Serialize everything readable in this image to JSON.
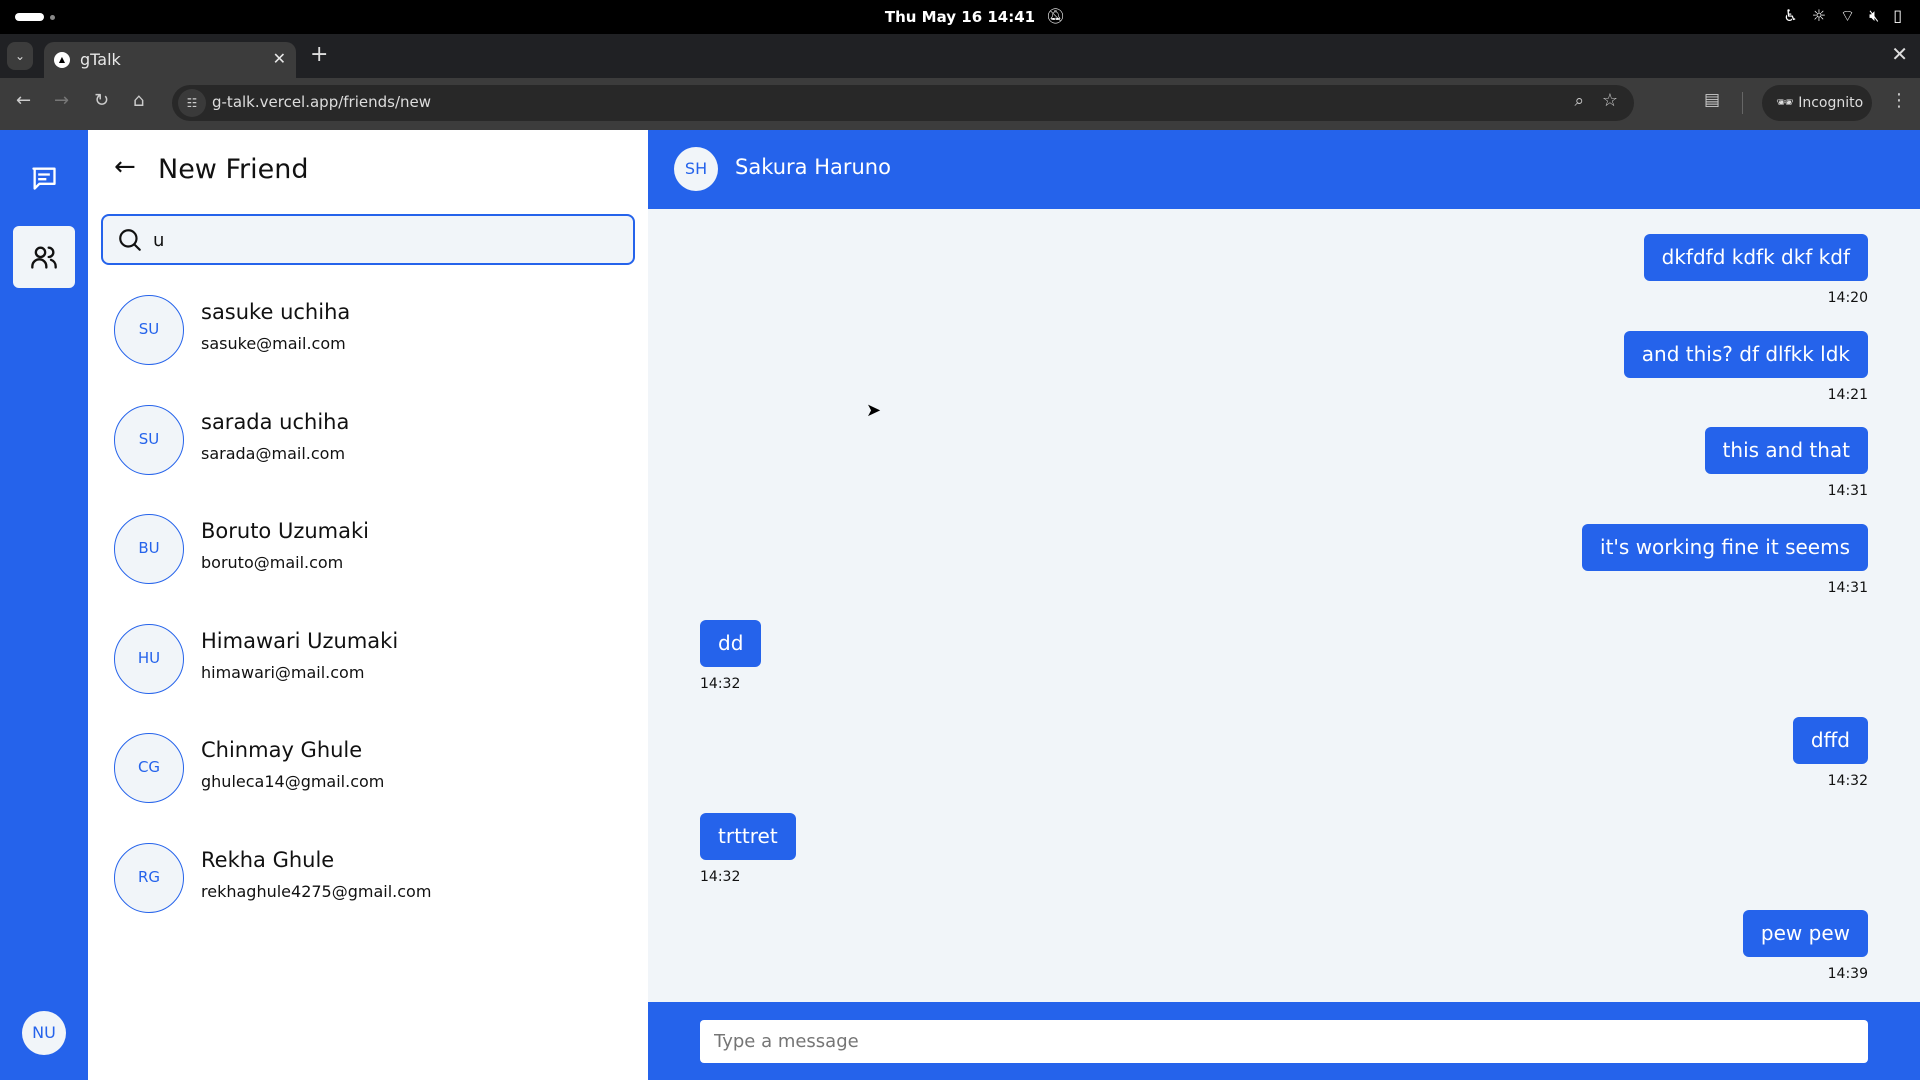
{
  "system": {
    "clock": "Thu May 16  14:41"
  },
  "browser": {
    "tab_title": "gTalk",
    "url": "g-talk.vercel.app/friends/new",
    "incognito_label": "Incognito"
  },
  "sidebar": {
    "user_initials": "NU"
  },
  "friends_panel": {
    "title": "New Friend",
    "search": {
      "value": "u",
      "placeholder": ""
    },
    "results": [
      {
        "initials": "SU",
        "name": "sasuke uchiha",
        "email": "sasuke@mail.com"
      },
      {
        "initials": "SU",
        "name": "sarada uchiha",
        "email": "sarada@mail.com"
      },
      {
        "initials": "BU",
        "name": "Boruto Uzumaki",
        "email": "boruto@mail.com"
      },
      {
        "initials": "HU",
        "name": "Himawari Uzumaki",
        "email": "himawari@mail.com"
      },
      {
        "initials": "CG",
        "name": "Chinmay Ghule",
        "email": "ghuleca14@gmail.com"
      },
      {
        "initials": "RG",
        "name": "Rekha Ghule",
        "email": "rekhaghule4275@gmail.com"
      }
    ]
  },
  "chat": {
    "contact": {
      "initials": "SH",
      "name": "Sakura Haruno"
    },
    "messages": [
      {
        "text": "dkfdfd kdfk dkf kdf",
        "time": "14:20",
        "from": "me"
      },
      {
        "text": "and this? df dlfkk ldk",
        "time": "14:21",
        "from": "me"
      },
      {
        "text": "this and that",
        "time": "14:31",
        "from": "me"
      },
      {
        "text": "it's working fine it seems",
        "time": "14:31",
        "from": "me"
      },
      {
        "text": "dd",
        "time": "14:32",
        "from": "them"
      },
      {
        "text": "dffd",
        "time": "14:32",
        "from": "me"
      },
      {
        "text": "trttret",
        "time": "14:32",
        "from": "them"
      },
      {
        "text": "pew pew",
        "time": "14:39",
        "from": "me"
      }
    ],
    "input_placeholder": "Type a message"
  },
  "colors": {
    "accent": "#2563eb",
    "surface": "#f1f5f9"
  }
}
